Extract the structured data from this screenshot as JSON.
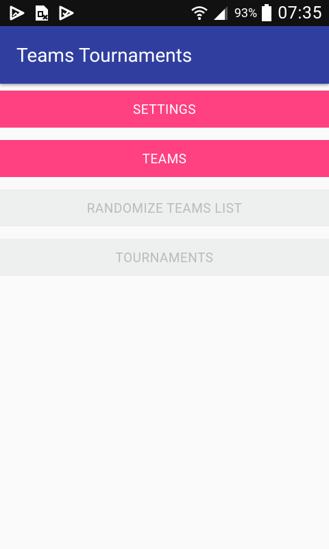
{
  "status_bar": {
    "left_icons": [
      "play-store-icon",
      "sim-card-icon",
      "task-check-icon"
    ],
    "battery_percent": "93%",
    "time": "07:35"
  },
  "app_bar": {
    "title": "Teams Tournaments",
    "color": "#303f9f"
  },
  "buttons": [
    {
      "label": "SETTINGS",
      "enabled": true
    },
    {
      "label": "TEAMS",
      "enabled": true
    },
    {
      "label": "RANDOMIZE TEAMS LIST",
      "enabled": false
    },
    {
      "label": "TOURNAMENTS",
      "enabled": false
    }
  ],
  "colors": {
    "accent": "#ff4081",
    "disabled_bg": "#eeefef",
    "disabled_text": "#b9bbbc",
    "background": "#fafafa"
  }
}
